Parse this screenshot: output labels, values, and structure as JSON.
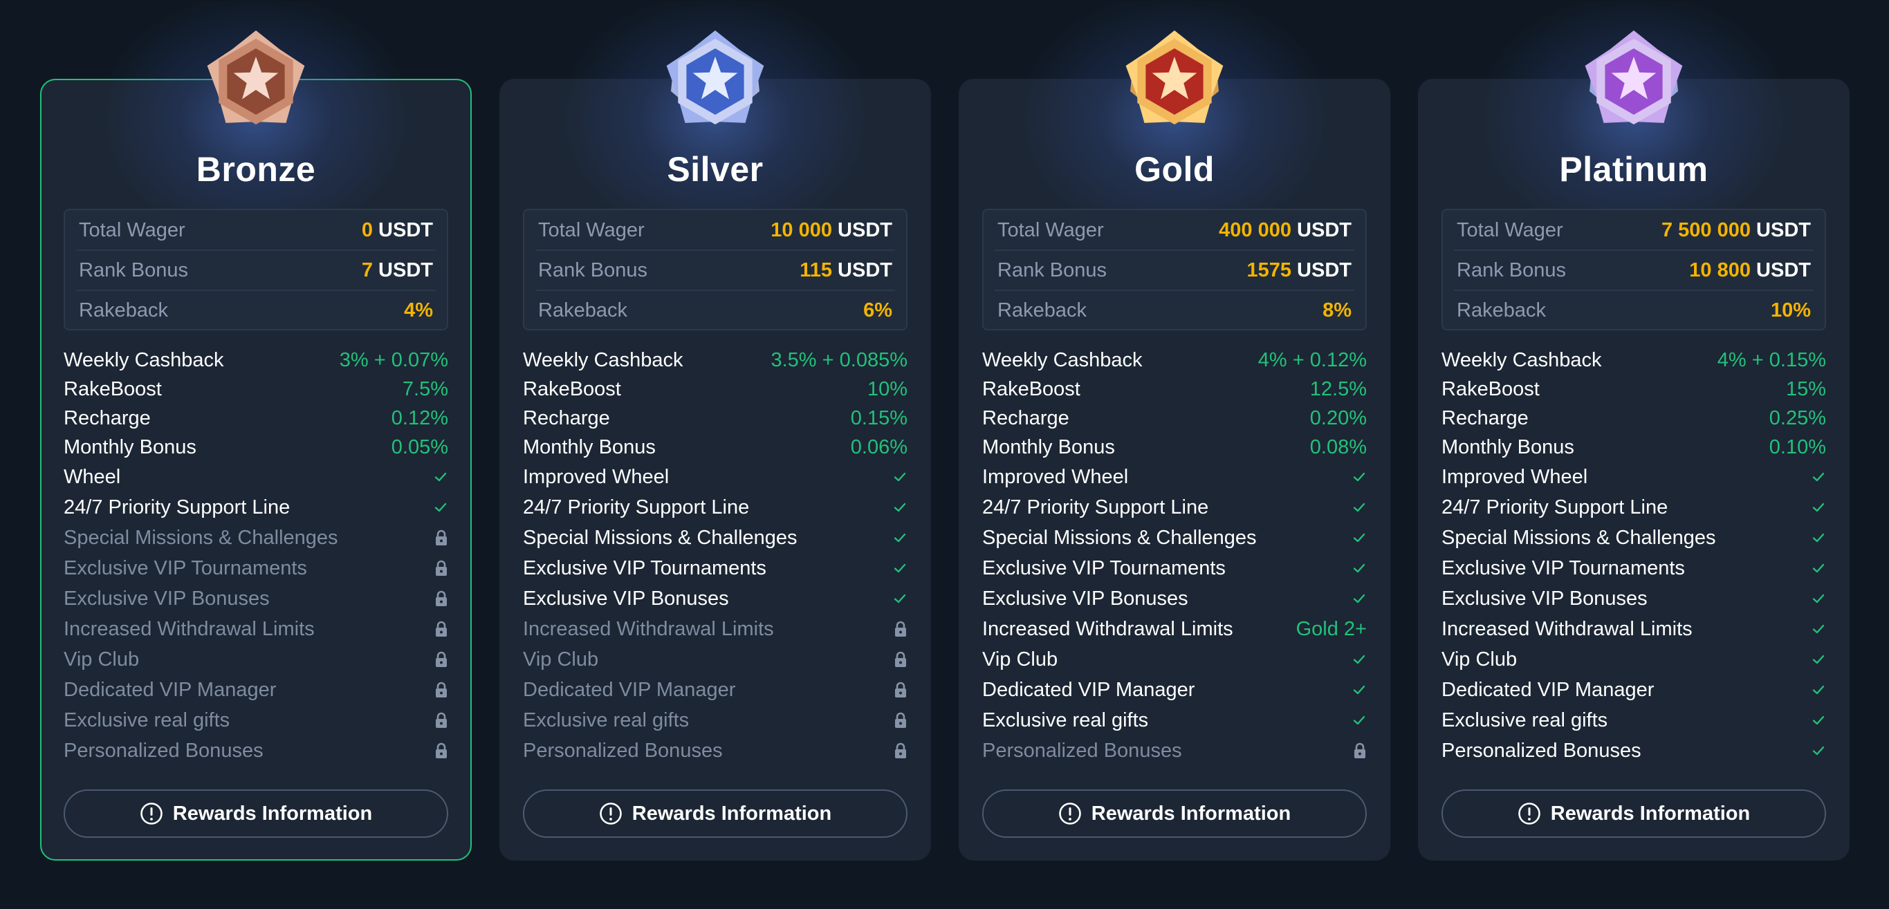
{
  "colors": {
    "background": "#0f1822",
    "card": "#1c2634",
    "accent_green": "#22c17a",
    "accent_gold": "#f4b400",
    "muted": "#7f8ca0"
  },
  "tiers": [
    {
      "name": "Bronze",
      "badge_icon": "bronze-medal-icon",
      "active": true,
      "total_wager_label": "Total Wager",
      "total_wager_value": "0",
      "rank_bonus_label": "Rank Bonus",
      "rank_bonus_value": "7",
      "rakeback_label": "Rakeback",
      "rakeback_value": "4%",
      "currency": "USDT",
      "features": [
        {
          "name": "Weekly Cashback",
          "value": "3% + 0.07%",
          "type": "text"
        },
        {
          "name": "RakeBoost",
          "value": "7.5%",
          "type": "text"
        },
        {
          "name": "Recharge",
          "value": "0.12%",
          "type": "text"
        },
        {
          "name": "Monthly Bonus",
          "value": "0.05%",
          "type": "text"
        },
        {
          "name": "Wheel",
          "value": "",
          "type": "check"
        },
        {
          "name": "24/7 Priority Support Line",
          "value": "",
          "type": "check"
        },
        {
          "name": "Special Missions & Challenges",
          "value": "",
          "type": "lock"
        },
        {
          "name": "Exclusive VIP Tournaments",
          "value": "",
          "type": "lock"
        },
        {
          "name": "Exclusive VIP Bonuses",
          "value": "",
          "type": "lock"
        },
        {
          "name": "Increased Withdrawal Limits",
          "value": "",
          "type": "lock"
        },
        {
          "name": "Vip Club",
          "value": "",
          "type": "lock"
        },
        {
          "name": "Dedicated VIP Manager",
          "value": "",
          "type": "lock"
        },
        {
          "name": "Exclusive real gifts",
          "value": "",
          "type": "lock"
        },
        {
          "name": "Personalized Bonuses",
          "value": "",
          "type": "lock"
        }
      ],
      "button_label": "Rewards Information"
    },
    {
      "name": "Silver",
      "badge_icon": "silver-medal-icon",
      "active": false,
      "total_wager_label": "Total Wager",
      "total_wager_value": "10 000",
      "rank_bonus_label": "Rank Bonus",
      "rank_bonus_value": "115",
      "rakeback_label": "Rakeback",
      "rakeback_value": "6%",
      "currency": "USDT",
      "features": [
        {
          "name": "Weekly Cashback",
          "value": "3.5% + 0.085%",
          "type": "text"
        },
        {
          "name": "RakeBoost",
          "value": "10%",
          "type": "text"
        },
        {
          "name": "Recharge",
          "value": "0.15%",
          "type": "text"
        },
        {
          "name": "Monthly Bonus",
          "value": "0.06%",
          "type": "text"
        },
        {
          "name": "Improved Wheel",
          "value": "",
          "type": "check"
        },
        {
          "name": "24/7 Priority Support Line",
          "value": "",
          "type": "check"
        },
        {
          "name": "Special Missions & Challenges",
          "value": "",
          "type": "check"
        },
        {
          "name": "Exclusive VIP Tournaments",
          "value": "",
          "type": "check"
        },
        {
          "name": "Exclusive VIP Bonuses",
          "value": "",
          "type": "check"
        },
        {
          "name": "Increased Withdrawal Limits",
          "value": "",
          "type": "lock"
        },
        {
          "name": "Vip Club",
          "value": "",
          "type": "lock"
        },
        {
          "name": "Dedicated VIP Manager",
          "value": "",
          "type": "lock"
        },
        {
          "name": "Exclusive real gifts",
          "value": "",
          "type": "lock"
        },
        {
          "name": "Personalized Bonuses",
          "value": "",
          "type": "lock"
        }
      ],
      "button_label": "Rewards Information"
    },
    {
      "name": "Gold",
      "badge_icon": "gold-medal-icon",
      "active": false,
      "total_wager_label": "Total Wager",
      "total_wager_value": "400 000",
      "rank_bonus_label": "Rank Bonus",
      "rank_bonus_value": "1575",
      "rakeback_label": "Rakeback",
      "rakeback_value": "8%",
      "currency": "USDT",
      "features": [
        {
          "name": "Weekly Cashback",
          "value": "4% + 0.12%",
          "type": "text"
        },
        {
          "name": "RakeBoost",
          "value": "12.5%",
          "type": "text"
        },
        {
          "name": "Recharge",
          "value": "0.20%",
          "type": "text"
        },
        {
          "name": "Monthly Bonus",
          "value": "0.08%",
          "type": "text"
        },
        {
          "name": "Improved Wheel",
          "value": "",
          "type": "check"
        },
        {
          "name": "24/7 Priority Support Line",
          "value": "",
          "type": "check"
        },
        {
          "name": "Special Missions & Challenges",
          "value": "",
          "type": "check"
        },
        {
          "name": "Exclusive VIP Tournaments",
          "value": "",
          "type": "check"
        },
        {
          "name": "Exclusive VIP Bonuses",
          "value": "",
          "type": "check"
        },
        {
          "name": "Increased Withdrawal Limits",
          "value": "Gold 2+",
          "type": "text"
        },
        {
          "name": "Vip Club",
          "value": "",
          "type": "check"
        },
        {
          "name": "Dedicated VIP Manager",
          "value": "",
          "type": "check"
        },
        {
          "name": "Exclusive real gifts",
          "value": "",
          "type": "check"
        },
        {
          "name": "Personalized Bonuses",
          "value": "",
          "type": "lock"
        }
      ],
      "button_label": "Rewards Information"
    },
    {
      "name": "Platinum",
      "badge_icon": "platinum-medal-icon",
      "active": false,
      "total_wager_label": "Total Wager",
      "total_wager_value": "7 500 000",
      "rank_bonus_label": "Rank Bonus",
      "rank_bonus_value": "10 800",
      "rakeback_label": "Rakeback",
      "rakeback_value": "10%",
      "currency": "USDT",
      "features": [
        {
          "name": "Weekly Cashback",
          "value": "4% + 0.15%",
          "type": "text"
        },
        {
          "name": "RakeBoost",
          "value": "15%",
          "type": "text"
        },
        {
          "name": "Recharge",
          "value": "0.25%",
          "type": "text"
        },
        {
          "name": "Monthly Bonus",
          "value": "0.10%",
          "type": "text"
        },
        {
          "name": "Improved Wheel",
          "value": "",
          "type": "check"
        },
        {
          "name": "24/7 Priority Support Line",
          "value": "",
          "type": "check"
        },
        {
          "name": "Special Missions & Challenges",
          "value": "",
          "type": "check"
        },
        {
          "name": "Exclusive VIP Tournaments",
          "value": "",
          "type": "check"
        },
        {
          "name": "Exclusive VIP Bonuses",
          "value": "",
          "type": "check"
        },
        {
          "name": "Increased Withdrawal Limits",
          "value": "",
          "type": "check"
        },
        {
          "name": "Vip Club",
          "value": "",
          "type": "check"
        },
        {
          "name": "Dedicated VIP Manager",
          "value": "",
          "type": "check"
        },
        {
          "name": "Exclusive real gifts",
          "value": "",
          "type": "check"
        },
        {
          "name": "Personalized Bonuses",
          "value": "",
          "type": "check"
        }
      ],
      "button_label": "Rewards Information"
    }
  ]
}
